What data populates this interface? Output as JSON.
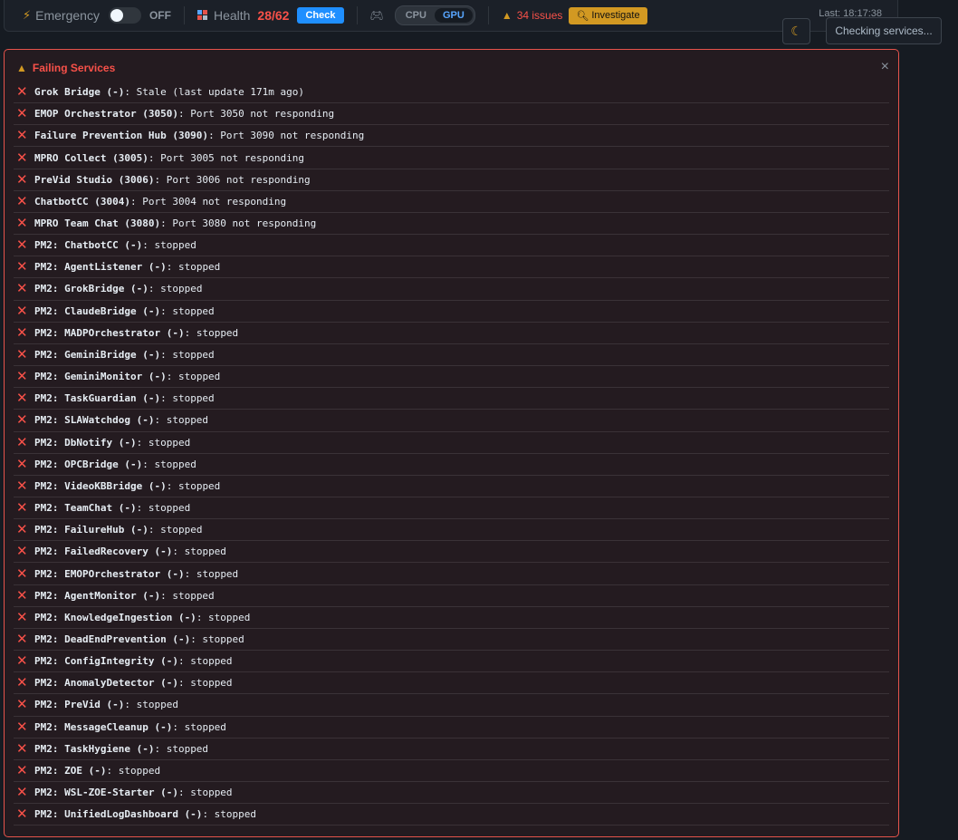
{
  "topbar": {
    "emergency_label": "Emergency",
    "emergency_state": "OFF",
    "health_label": "Health",
    "health_value": "28/62",
    "check_button": "Check",
    "cpu_label": "CPU",
    "gpu_label": "GPU",
    "issues_text": "34 issues",
    "investigate_button": "Investigate",
    "last_text": "Last: 18:17:38"
  },
  "status_popup": "Checking services...",
  "panel": {
    "title": "Failing Services",
    "close_symbol": "×",
    "items": [
      {
        "name": "Grok Bridge (-)",
        "detail": ": Stale (last update 171m ago)"
      },
      {
        "name": "EMOP Orchestrator (3050)",
        "detail": ": Port 3050 not responding"
      },
      {
        "name": "Failure Prevention Hub (3090)",
        "detail": ": Port 3090 not responding"
      },
      {
        "name": "MPRO Collect (3005)",
        "detail": ": Port 3005 not responding"
      },
      {
        "name": "PreVid Studio (3006)",
        "detail": ": Port 3006 not responding"
      },
      {
        "name": "ChatbotCC (3004)",
        "detail": ": Port 3004 not responding"
      },
      {
        "name": "MPRO Team Chat (3080)",
        "detail": ": Port 3080 not responding"
      },
      {
        "name": "PM2: ChatbotCC (-)",
        "detail": ": stopped"
      },
      {
        "name": "PM2: AgentListener (-)",
        "detail": ": stopped"
      },
      {
        "name": "PM2: GrokBridge (-)",
        "detail": ": stopped"
      },
      {
        "name": "PM2: ClaudeBridge (-)",
        "detail": ": stopped"
      },
      {
        "name": "PM2: MADPOrchestrator (-)",
        "detail": ": stopped"
      },
      {
        "name": "PM2: GeminiBridge (-)",
        "detail": ": stopped"
      },
      {
        "name": "PM2: GeminiMonitor (-)",
        "detail": ": stopped"
      },
      {
        "name": "PM2: TaskGuardian (-)",
        "detail": ": stopped"
      },
      {
        "name": "PM2: SLAWatchdog (-)",
        "detail": ": stopped"
      },
      {
        "name": "PM2: DbNotify (-)",
        "detail": ": stopped"
      },
      {
        "name": "PM2: OPCBridge (-)",
        "detail": ": stopped"
      },
      {
        "name": "PM2: VideoKBBridge (-)",
        "detail": ": stopped"
      },
      {
        "name": "PM2: TeamChat (-)",
        "detail": ": stopped"
      },
      {
        "name": "PM2: FailureHub (-)",
        "detail": ": stopped"
      },
      {
        "name": "PM2: FailedRecovery (-)",
        "detail": ": stopped"
      },
      {
        "name": "PM2: EMOPOrchestrator (-)",
        "detail": ": stopped"
      },
      {
        "name": "PM2: AgentMonitor (-)",
        "detail": ": stopped"
      },
      {
        "name": "PM2: KnowledgeIngestion (-)",
        "detail": ": stopped"
      },
      {
        "name": "PM2: DeadEndPrevention (-)",
        "detail": ": stopped"
      },
      {
        "name": "PM2: ConfigIntegrity (-)",
        "detail": ": stopped"
      },
      {
        "name": "PM2: AnomalyDetector (-)",
        "detail": ": stopped"
      },
      {
        "name": "PM2: PreVid (-)",
        "detail": ": stopped"
      },
      {
        "name": "PM2: MessageCleanup (-)",
        "detail": ": stopped"
      },
      {
        "name": "PM2: TaskHygiene (-)",
        "detail": ": stopped"
      },
      {
        "name": "PM2: ZOE (-)",
        "detail": ": stopped"
      },
      {
        "name": "PM2: WSL-ZOE-Starter (-)",
        "detail": ": stopped"
      },
      {
        "name": "PM2: UnifiedLogDashboard (-)",
        "detail": ": stopped"
      }
    ]
  },
  "colors": {
    "danger": "#f85149",
    "warning": "#d29922",
    "accent": "#1f8fff",
    "panel_border": "#e5534b"
  }
}
